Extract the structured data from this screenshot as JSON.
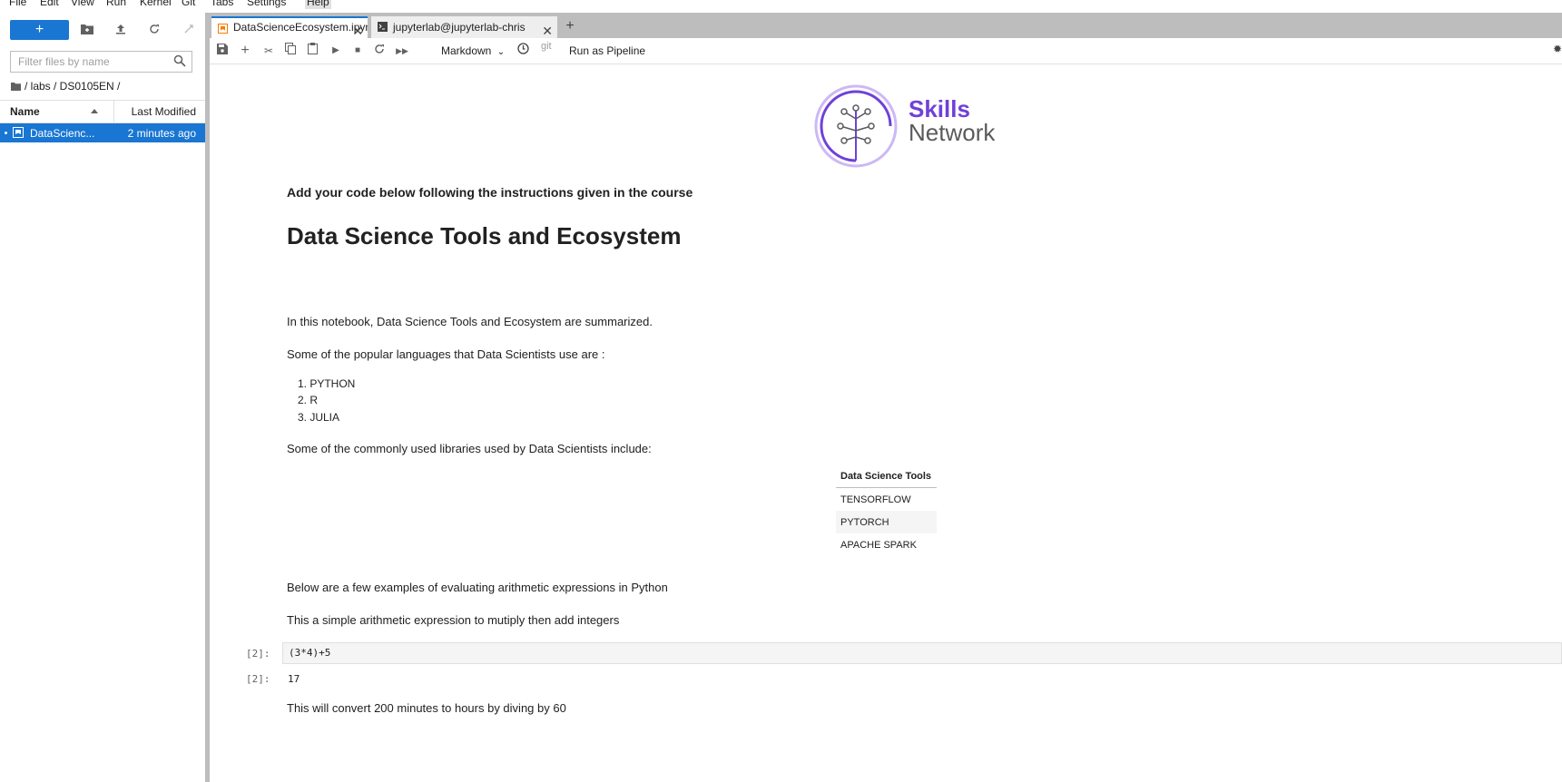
{
  "menubar": {
    "items": [
      "File",
      "Edit",
      "View",
      "Run",
      "Kernel",
      "Git",
      "Tabs",
      "Settings",
      "Help"
    ]
  },
  "sidebar": {
    "new_label": "+",
    "filter_placeholder": "Filter files by name",
    "breadcrumb": "/ labs / DS0105EN /",
    "header": {
      "name": "Name",
      "modified": "Last Modified"
    },
    "files": [
      {
        "name": "DataScienc...",
        "modified": "2 minutes ago"
      }
    ]
  },
  "tabs": [
    {
      "label": "DataScienceEcosystem.ipyn",
      "active": true
    },
    {
      "label": "jupyterlab@jupyterlab-chris",
      "active": false
    }
  ],
  "toolbar": {
    "cell_type": "Markdown",
    "git": "git",
    "run_pipeline": "Run as Pipeline"
  },
  "logo": {
    "line1": "Skills",
    "line2": "Network"
  },
  "notebook": {
    "intro": "Add your code below following the instructions given in the course",
    "title": "Data Science Tools and Ecosystem",
    "summary": "In this notebook, Data Science Tools and Ecosystem are summarized.",
    "languages_intro": "Some of the popular languages that Data Scientists use are :",
    "languages": [
      "1. PYTHON",
      "2. R",
      "3. JULIA"
    ],
    "libraries_intro": "Some of the commonly used libraries used by Data Scientists include:",
    "tools_table": {
      "header": "Data Science Tools",
      "rows": [
        "TENSORFLOW",
        "PYTORCH",
        "APACHE SPARK"
      ]
    },
    "arith_intro": "Below are a few examples of evaluating arithmetic expressions in Python",
    "arith_simple": "This a simple arithmetic expression to mutiply then add integers",
    "cell_prompt": "[2]:",
    "cell_code": "(3*4)+5",
    "output_prompt": "[2]:",
    "output_value": "17",
    "convert_text": "This will convert 200 minutes to hours by diving by 60"
  },
  "colors": {
    "accent": "#1976d2",
    "logo_purple": "#6f41d8",
    "logo_gray": "#5a5a5a"
  }
}
